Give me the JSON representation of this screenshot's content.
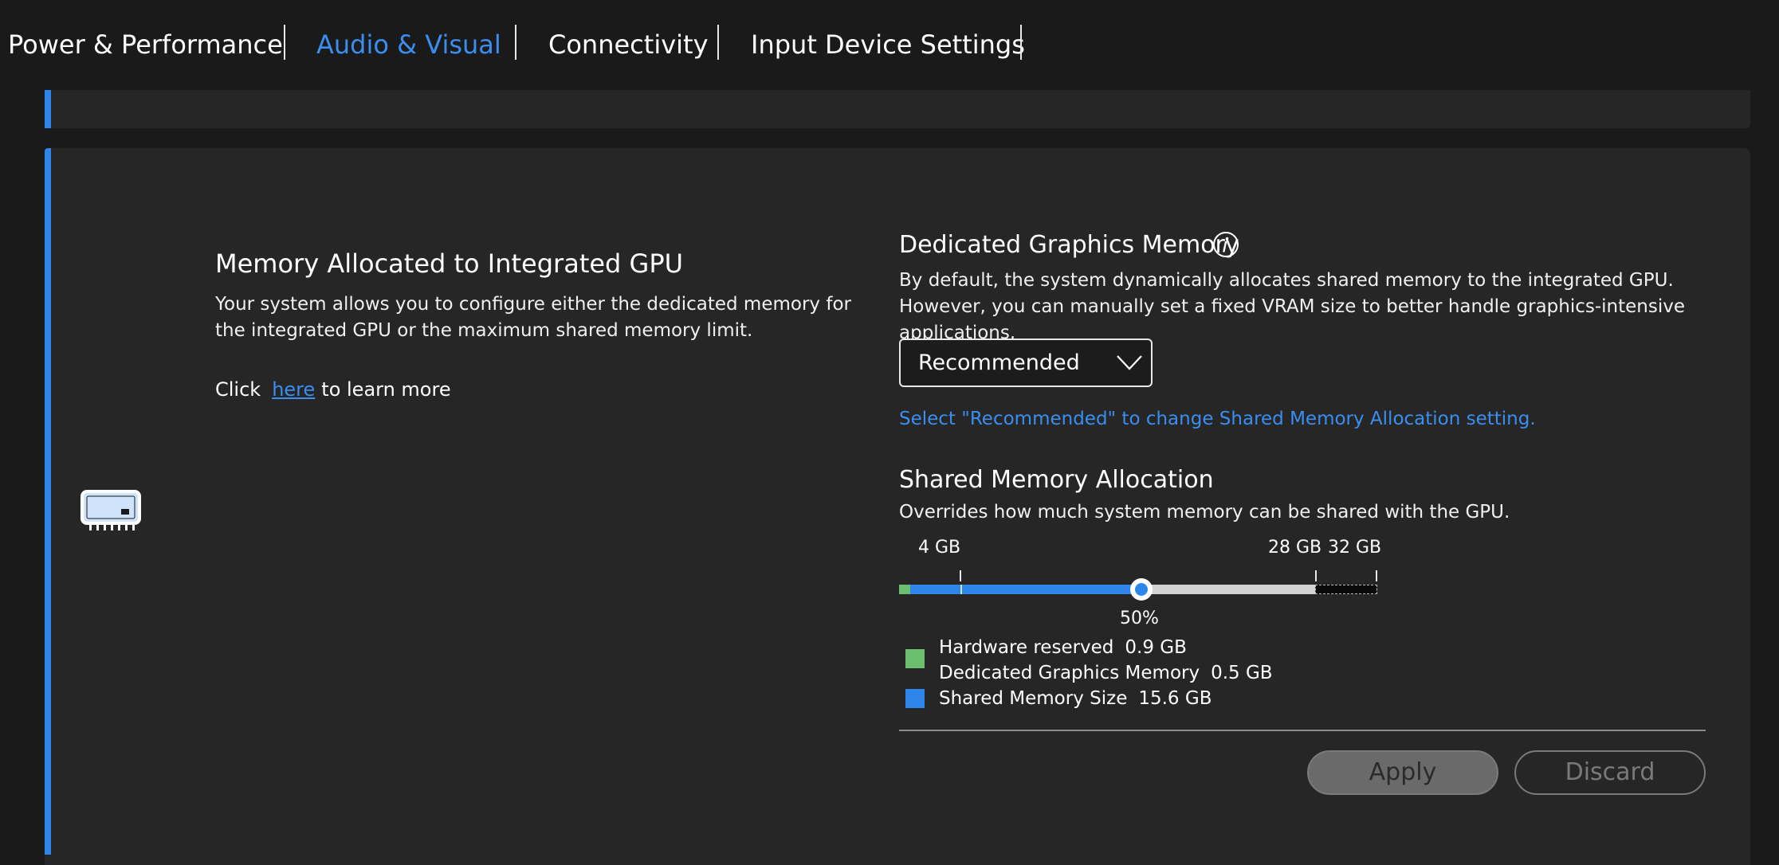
{
  "tabs": [
    {
      "label": "Power & Performance",
      "active": false
    },
    {
      "label": "Audio & Visual",
      "active": true
    },
    {
      "label": "Connectivity",
      "active": false
    },
    {
      "label": "Input Device Settings",
      "active": false
    }
  ],
  "colors": {
    "accent": "#2f86ea",
    "link": "#3a8ef0",
    "hardware_reserved": "#6bbf6e",
    "shared": "#2f86ea",
    "background": "#1a1a1a",
    "card": "#262626"
  },
  "icons": {
    "section": "gpu-memory-icon",
    "info": "info-icon",
    "dropdown": "chevron-down-icon"
  },
  "left": {
    "title": "Memory Allocated to Integrated GPU",
    "description": "Your system allows you to configure either the dedicated memory for the integrated GPU or the maximum shared memory limit.",
    "learn_prefix": "Click",
    "learn_link": "here",
    "learn_suffix": "to learn more"
  },
  "dedicated": {
    "title": "Dedicated Graphics Memory",
    "description": "By default, the system dynamically allocates shared memory to the integrated GPU. However, you can manually set a fixed VRAM size to better handle graphics-intensive applications.",
    "selected": "Recommended",
    "hint": "Select \"Recommended\" to change Shared Memory Allocation setting."
  },
  "shared": {
    "title": "Shared Memory Allocation",
    "description": "Overrides how much system memory can be shared with the GPU.",
    "slider": {
      "labels": {
        "min": "4 GB",
        "limit": "28 GB",
        "max": "32 GB"
      },
      "value_percent": 50,
      "value_label": "50%"
    },
    "legend": [
      {
        "label": "Hardware reserved",
        "value": "0.9 GB"
      },
      {
        "label": "Dedicated Graphics Memory",
        "value": "0.5 GB"
      },
      {
        "label": "Shared Memory Size",
        "value": "15.6 GB"
      }
    ]
  },
  "buttons": {
    "apply": "Apply",
    "discard": "Discard"
  }
}
